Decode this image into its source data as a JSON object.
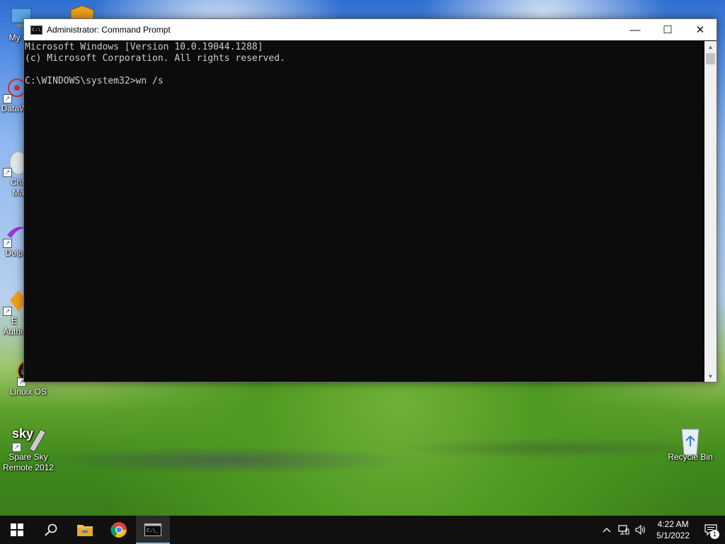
{
  "desktop": {
    "icons": [
      {
        "label": "My Co",
        "icon": "computer-icon"
      },
      {
        "label": "DataW",
        "icon": "datawall-icon"
      },
      {
        "label": "Cha Ma",
        "icon": "character-map-icon"
      },
      {
        "label": "Dolp",
        "icon": "dolphin-icon"
      },
      {
        "label": "E Authe",
        "icon": "authenticator-icon"
      },
      {
        "label": "Linuix OS",
        "icon": "linux-os-icon"
      },
      {
        "label": "Spare Sky Remote 2012",
        "icon": "sky-remote-icon"
      },
      {
        "label": "Recycle Bin",
        "icon": "recycle-bin-icon"
      }
    ]
  },
  "window": {
    "title": "Administrator: Command Prompt",
    "controls": {
      "minimize": "—",
      "maximize": "☐",
      "close": "✕"
    },
    "console_lines": [
      "Microsoft Windows [Version 10.0.19044.1288]",
      "(c) Microsoft Corporation. All rights reserved.",
      "",
      "C:\\WINDOWS\\system32>wn /s"
    ]
  },
  "taskbar": {
    "apps": [
      "start-icon",
      "search-icon",
      "file-explorer-icon",
      "chrome-icon",
      "command-prompt-icon"
    ],
    "tray": {
      "time": "4:22 AM",
      "date": "5/1/2022",
      "notification_count": "1"
    }
  },
  "colors": {
    "console_bg": "#0c0c0c",
    "console_text": "#cccccc",
    "taskbar_bg": "#101010",
    "active_indicator": "#76b9ed"
  }
}
